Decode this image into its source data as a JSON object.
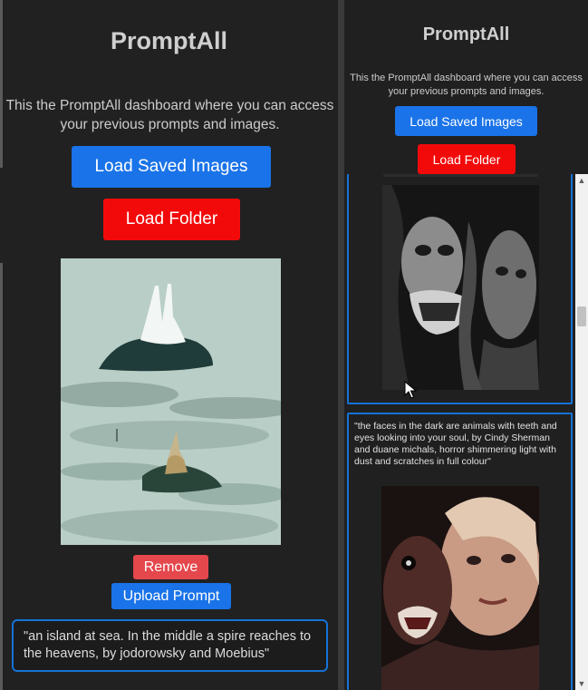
{
  "left_panel": {
    "title": "PromptAll",
    "description": "This the PromptAll dashboard where you can access your previous prompts and images.",
    "load_saved_images_label": "Load Saved Images",
    "load_folder_label": "Load Folder",
    "remove_label": "Remove",
    "upload_prompt_label": "Upload Prompt",
    "prompt_text": "\"an island at sea. In the middle a spire reaches to the heavens, by jodorowsky and Moebius\""
  },
  "right_panel": {
    "title": "PromptAll",
    "description": "This the PromptAll dashboard where you can access your previous prompts and images.",
    "load_saved_images_label": "Load Saved Images",
    "load_folder_label": "Load Folder",
    "cards": [
      {
        "prompt_text": ""
      },
      {
        "prompt_text": "\"the faces in the dark are animals with teeth and eyes looking into your soul, by Cindy Sherman and duane michals, horror shimmering light with dust and scratches in full colour\""
      }
    ]
  },
  "icons": {
    "scroll_up": "chevron-up-icon",
    "scroll_down": "chevron-down-icon",
    "cursor": "mouse-pointer-icon"
  },
  "colors": {
    "background": "#212121",
    "primary_button": "#1a73e8",
    "danger_button": "#f20a0a",
    "remove_button": "#e4474c",
    "card_border": "#1572d6"
  }
}
